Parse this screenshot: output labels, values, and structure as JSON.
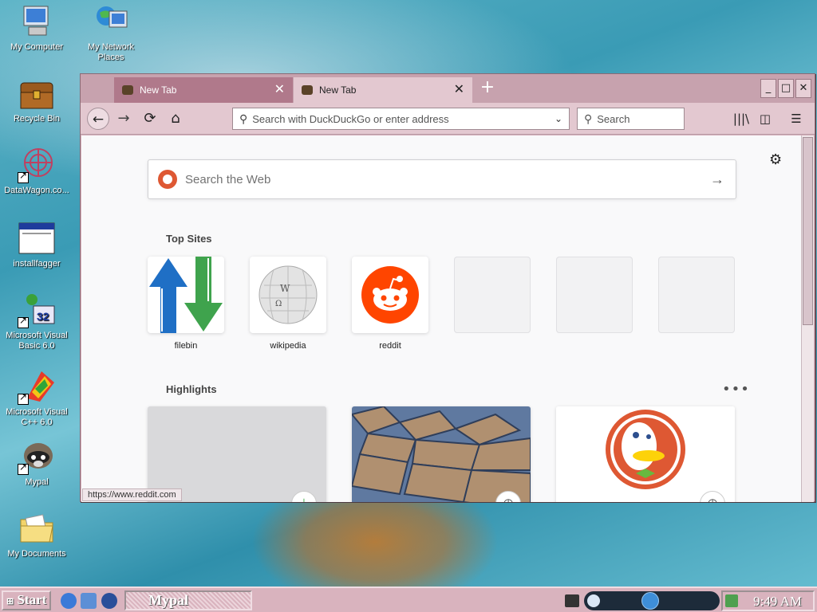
{
  "desktop": {
    "icons": [
      {
        "label": "My Computer"
      },
      {
        "label": "My Network Places"
      },
      {
        "label": "Recycle Bin"
      },
      {
        "label": "DataWagon.co..."
      },
      {
        "label": "installfagger"
      },
      {
        "label": "Microsoft Visual Basic 6.0"
      },
      {
        "label": "Microsoft Visual C++ 6.0"
      },
      {
        "label": "Mypal"
      },
      {
        "label": "My Documents"
      }
    ]
  },
  "browser": {
    "tabs": [
      {
        "title": "New Tab",
        "active": false
      },
      {
        "title": "New Tab",
        "active": true
      }
    ],
    "urlbar_placeholder": "Search with DuckDuckGo or enter address",
    "search_placeholder": "Search",
    "web_search_placeholder": "Search the Web",
    "top_sites_title": "Top Sites",
    "top_sites": [
      {
        "label": "filebin"
      },
      {
        "label": "wikipedia"
      },
      {
        "label": "reddit"
      },
      {
        "label": ""
      },
      {
        "label": ""
      },
      {
        "label": ""
      }
    ],
    "highlights_title": "Highlights",
    "status_url": "https://www.reddit.com"
  },
  "taskbar": {
    "start_label": "Start",
    "task_label": "Mypal",
    "clock": "9:49 AM"
  },
  "colors": {
    "reddit": "#ff4500",
    "duckduckgo": "#de5833",
    "filebin_blue": "#1f6fc5",
    "filebin_green": "#3fa34d"
  }
}
